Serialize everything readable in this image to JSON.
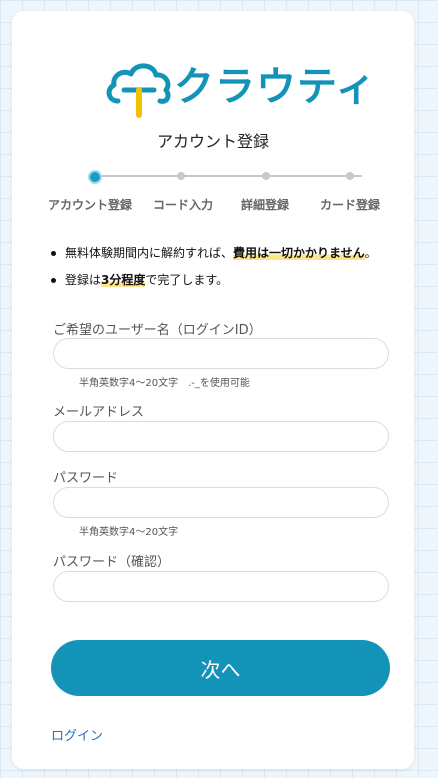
{
  "brand": {
    "name": "クラウティ",
    "logo_letter": "T",
    "primary_color": "#1493b8",
    "accent_color": "#f2c200"
  },
  "page": {
    "title": "アカウント登録"
  },
  "steps": [
    {
      "label": "アカウント登録",
      "active": true
    },
    {
      "label": "コード入力",
      "active": false
    },
    {
      "label": "詳細登録",
      "active": false
    },
    {
      "label": "カード登録",
      "active": false
    }
  ],
  "notes": {
    "n1_pre": "無料体験期間内に解約すれば、",
    "n1_hl": "費用は一切かかりません",
    "n1_post": "。",
    "n2_pre": "登録は",
    "n2_hl": "3分程度",
    "n2_post": "で完了します。"
  },
  "form": {
    "username_label": "ご希望のユーザー名（ログインID）",
    "username_value": "",
    "username_hint": "半角英数字4〜20文字　.-_を使用可能",
    "email_label": "メールアドレス",
    "email_value": "",
    "password_label": "パスワード",
    "password_value": "",
    "password_hint": "半角英数字4〜20文字",
    "password_confirm_label": "パスワード（確認）",
    "password_confirm_value": ""
  },
  "actions": {
    "next_label": "次へ",
    "login_label": "ログイン"
  }
}
